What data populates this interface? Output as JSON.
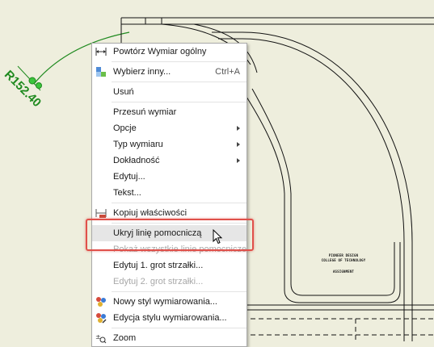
{
  "drawing": {
    "dimension_label": "R152.40",
    "title_block": [
      "PIONEER DESIGN",
      "COLLEGE OF TECHNOLOGY",
      "ASSIGNMENT"
    ]
  },
  "menu": {
    "items": [
      {
        "label": "Powtórz Wymiar ogólny",
        "icon": "dimension-icon"
      },
      {
        "label": "Wybierz inny...",
        "shortcut": "Ctrl+A",
        "icon": "select-other-icon"
      },
      {
        "label": "Usuń"
      },
      {
        "label": "Przesuń wymiar"
      },
      {
        "label": "Opcje",
        "submenu": true
      },
      {
        "label": "Typ wymiaru",
        "submenu": true
      },
      {
        "label": "Dokładność",
        "submenu": true
      },
      {
        "label": "Edytuj..."
      },
      {
        "label": "Tekst..."
      },
      {
        "label": "Kopiuj właściwości",
        "icon": "copy-properties-icon"
      },
      {
        "label": "Ukryj linię pomocniczą",
        "highlighted": true
      },
      {
        "label": "Pokaż wszystkie linie pomocnicze",
        "disabled": true
      },
      {
        "label": "Edytuj 1. grot strzałki..."
      },
      {
        "label": "Edytuj 2. grot strzałki...",
        "disabled": true
      },
      {
        "label": "Nowy styl wymiarowania...",
        "icon": "new-style-icon"
      },
      {
        "label": "Edycja stylu wymiarowania...",
        "icon": "edit-style-icon"
      },
      {
        "label": "Zoom",
        "icon": "zoom-icon"
      }
    ]
  },
  "colors": {
    "background": "#eeeedd",
    "dimension_green": "#1f8a1f",
    "highlight_red": "#e0504a"
  }
}
